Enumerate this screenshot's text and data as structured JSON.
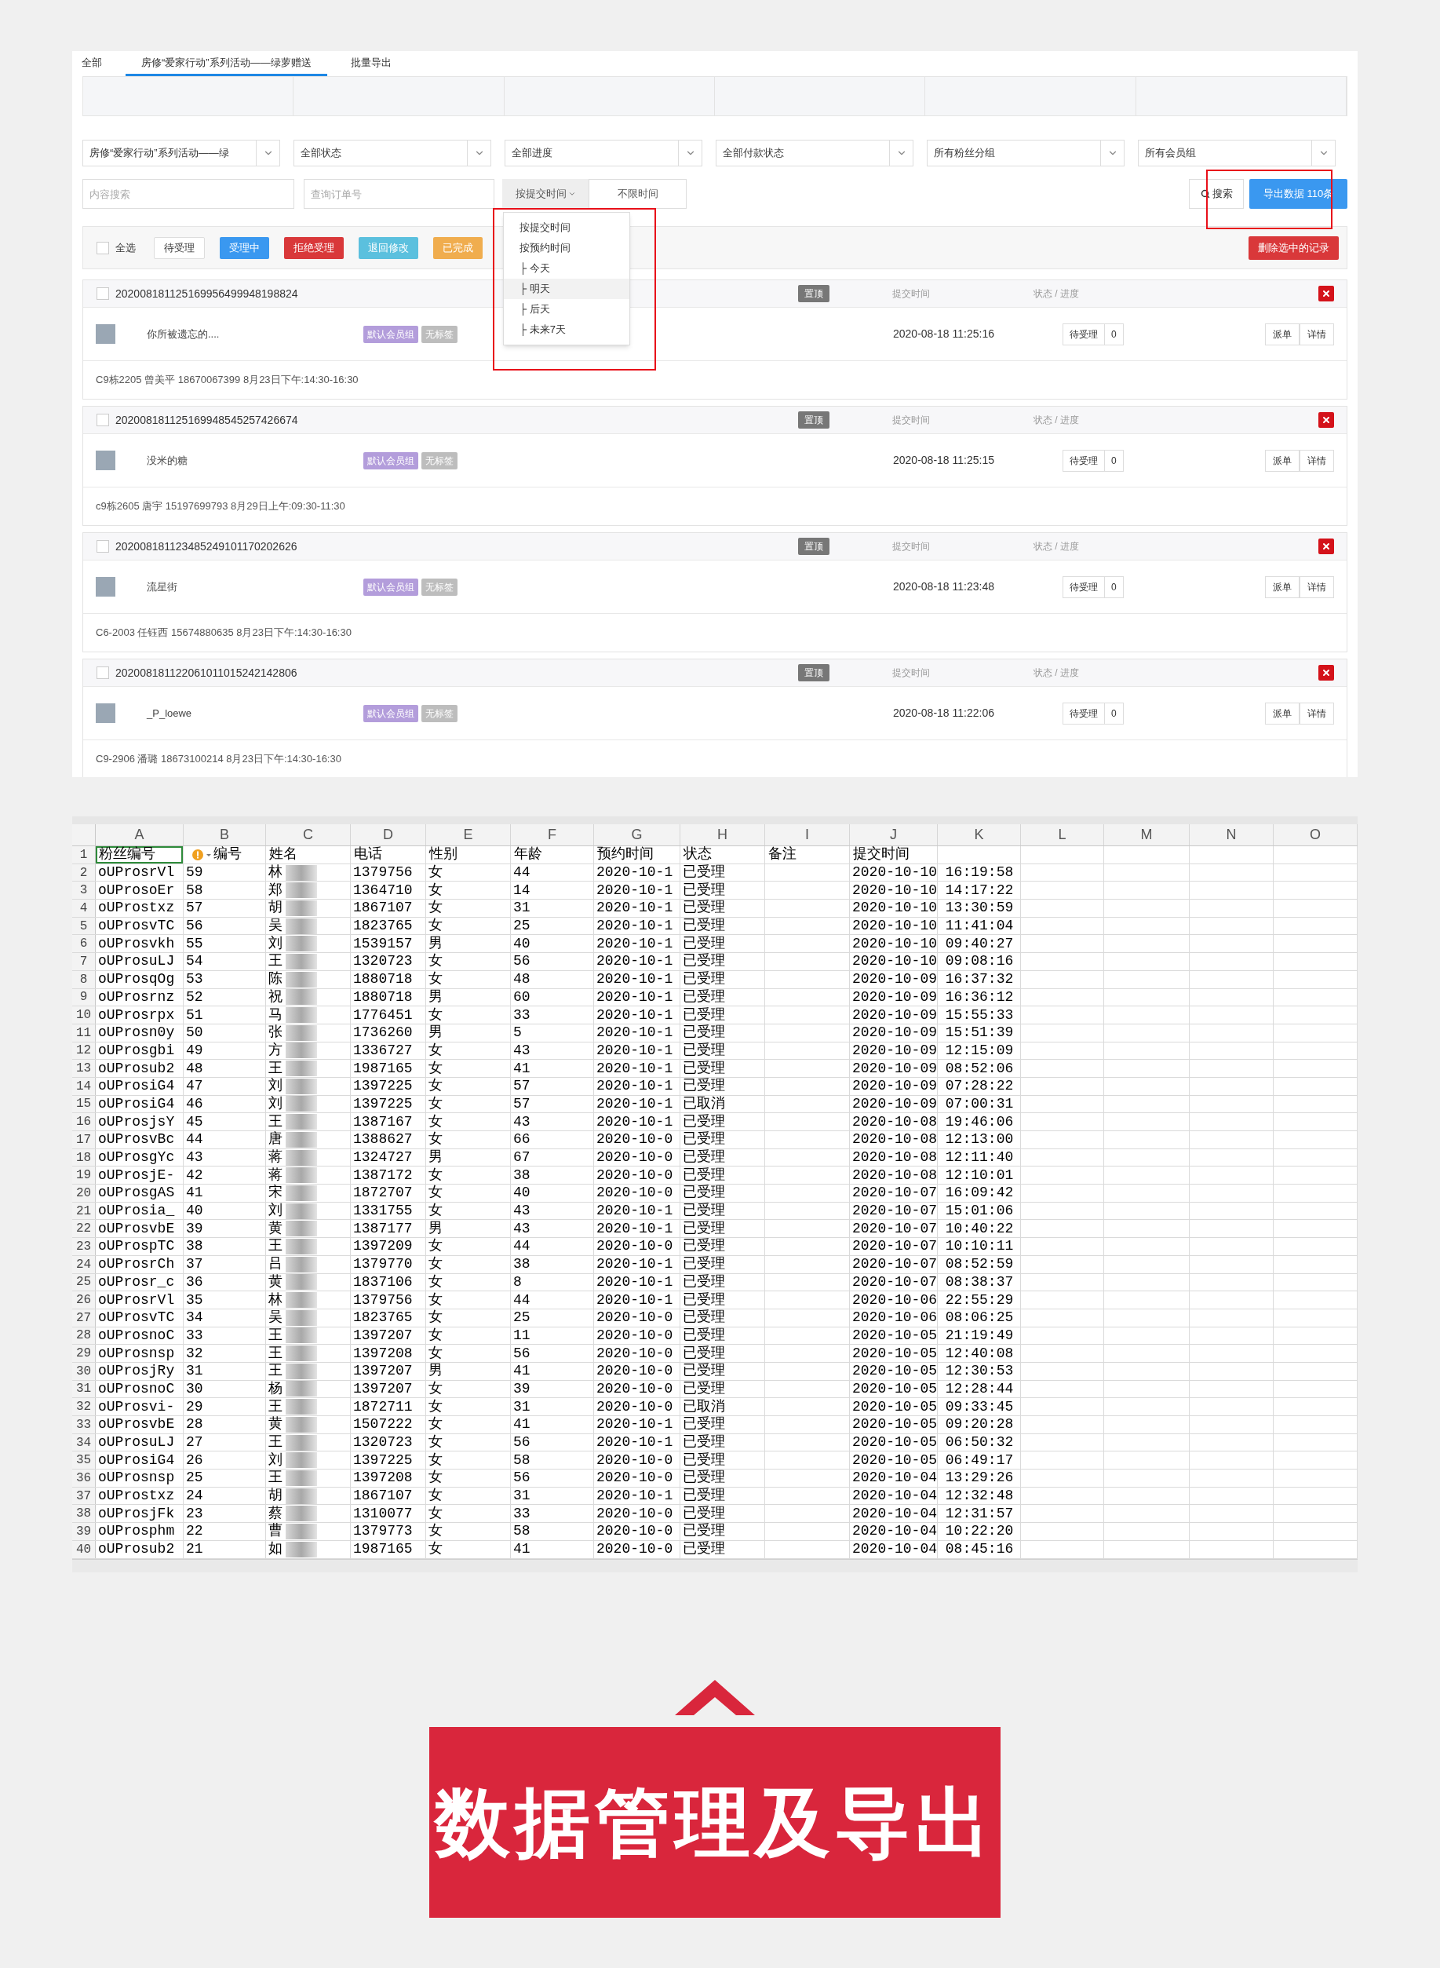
{
  "tabs": [
    {
      "label": "全部",
      "selected": false
    },
    {
      "label": "房修“爱家行动”系列活动——绿萝赠送",
      "selected": true
    },
    {
      "label": "批量导出",
      "selected": false
    }
  ],
  "filters": [
    "房修“爱家行动”系列活动——绿",
    "全部状态",
    "全部进度",
    "全部付款状态",
    "所有粉丝分组",
    "所有会员组"
  ],
  "search_fields": [
    {
      "placeholder": "内容搜索"
    },
    {
      "placeholder": "查询订单号"
    }
  ],
  "time_filter": {
    "mode": "按提交时间",
    "range": "不限时间"
  },
  "search_button": "搜索",
  "export_button": "导出数据 110条",
  "time_menu": [
    {
      "label": "按提交时间",
      "selected": false
    },
    {
      "label": "按预约时间",
      "selected": false
    },
    {
      "label": "├ 今天",
      "selected": false
    },
    {
      "label": "├ 明天",
      "selected": true
    },
    {
      "label": "├ 后天",
      "selected": false
    },
    {
      "label": "├ 未来7天",
      "selected": false
    }
  ],
  "toolbar": {
    "select_all": {
      "label": "全选",
      "checked": false
    },
    "status_buttons": [
      {
        "label": "待受理",
        "kind": "default"
      },
      {
        "label": "受理中",
        "kind": "primary"
      },
      {
        "label": "拒绝受理",
        "kind": "danger"
      },
      {
        "label": "退回修改",
        "kind": "info"
      },
      {
        "label": "已完成",
        "kind": "warning"
      }
    ],
    "delete_button": "删除选中的记录"
  },
  "orders": [
    {
      "order_no": "202008181125169956499948198824",
      "checked": false,
      "pin": "置顶",
      "time_label": "提交时间",
      "status_label": "状态 / 进度",
      "nickname": "你所被遗忘的....",
      "tags": [
        {
          "text": "默认会员组",
          "color": "#b39ddb"
        },
        {
          "text": "无标签",
          "color": "#bdbdbd"
        }
      ],
      "time": "2020-08-18 11:25:16",
      "status": "待受理",
      "count": "0",
      "actions": [
        "派单",
        "详情"
      ],
      "note": "C9栋2205 曾美平 18670067399 8月23日下午:14:30-16:30"
    },
    {
      "order_no": "202008181125169948545257426674",
      "checked": false,
      "pin": "置顶",
      "time_label": "提交时间",
      "status_label": "状态 / 进度",
      "nickname": "没米的糖",
      "tags": [
        {
          "text": "默认会员组",
          "color": "#b39ddb"
        },
        {
          "text": "无标签",
          "color": "#bdbdbd"
        }
      ],
      "time": "2020-08-18 11:25:15",
      "status": "待受理",
      "count": "0",
      "actions": [
        "派单",
        "详情"
      ],
      "note": "c9栋2605 唐宇 15197699793 8月29日上午:09:30-11:30"
    },
    {
      "order_no": "202008181123485249101170202626",
      "checked": false,
      "pin": "置顶",
      "time_label": "提交时间",
      "status_label": "状态 / 进度",
      "nickname": "流星街",
      "tags": [
        {
          "text": "默认会员组",
          "color": "#b39ddb"
        },
        {
          "text": "无标签",
          "color": "#bdbdbd"
        }
      ],
      "time": "2020-08-18 11:23:48",
      "status": "待受理",
      "count": "0",
      "actions": [
        "派单",
        "详情"
      ],
      "note": "C6-2003 任钰西 15674880635 8月23日下午:14:30-16:30"
    },
    {
      "order_no": "202008181122061011015242142806",
      "checked": false,
      "pin": "置顶",
      "time_label": "提交时间",
      "status_label": "状态 / 进度",
      "nickname": "_P_loewe",
      "tags": [
        {
          "text": "默认会员组",
          "color": "#b39ddb"
        },
        {
          "text": "无标签",
          "color": "#bdbdbd"
        }
      ],
      "time": "2020-08-18 11:22:06",
      "status": "待受理",
      "count": "0",
      "actions": [
        "派单",
        "详情"
      ],
      "note": "C9-2906 潘璐 18673100214 8月23日下午:14:30-16:30"
    }
  ],
  "sheet": {
    "columns": [
      "A",
      "B",
      "C",
      "D",
      "E",
      "F",
      "G",
      "H",
      "I",
      "J",
      "K",
      "L",
      "M",
      "N",
      "O"
    ],
    "header": {
      "n": "1",
      "cells": [
        {
          "text": "粉丝编号",
          "selected": true,
          "warning": false
        },
        {
          "text": "编号",
          "selected": false,
          "warning": true
        },
        {
          "text": "姓名",
          "selected": false,
          "warning": false
        },
        {
          "text": "电话",
          "selected": false,
          "warning": false
        },
        {
          "text": "性别",
          "selected": false,
          "warning": false
        },
        {
          "text": "年龄",
          "selected": false,
          "warning": false
        },
        {
          "text": "预约时间",
          "selected": false,
          "warning": false
        },
        {
          "text": "状态",
          "selected": false,
          "warning": false
        },
        {
          "text": "备注",
          "selected": false,
          "warning": false
        },
        {
          "text": "提交时间",
          "selected": false,
          "warning": false
        }
      ]
    },
    "rows": [
      {
        "n": "2",
        "cells": [
          "oUProsrVl",
          "59",
          "林",
          "1379756",
          "女",
          "44",
          "2020-10-1",
          "已受理",
          "2020-10-10 16:19:58"
        ]
      },
      {
        "n": "3",
        "cells": [
          "oUProsoEr",
          "58",
          "郑",
          "1364710",
          "女",
          "14",
          "2020-10-1",
          "已受理",
          "2020-10-10 14:17:22"
        ]
      },
      {
        "n": "4",
        "cells": [
          "oUProstxz",
          "57",
          "胡",
          "1867107",
          "女",
          "31",
          "2020-10-1",
          "已受理",
          "2020-10-10 13:30:59"
        ]
      },
      {
        "n": "5",
        "cells": [
          "oUProsvTC",
          "56",
          "吴",
          "1823765",
          "女",
          "25",
          "2020-10-1",
          "已受理",
          "2020-10-10 11:41:04"
        ]
      },
      {
        "n": "6",
        "cells": [
          "oUProsvkh",
          "55",
          "刘",
          "1539157",
          "男",
          "40",
          "2020-10-1",
          "已受理",
          "2020-10-10 09:40:27"
        ]
      },
      {
        "n": "7",
        "cells": [
          "oUProsuLJ",
          "54",
          "王",
          "1320723",
          "女",
          "56",
          "2020-10-1",
          "已受理",
          "2020-10-10 09:08:16"
        ]
      },
      {
        "n": "8",
        "cells": [
          "oUProsqOg",
          "53",
          "陈",
          "1880718",
          "女",
          "48",
          "2020-10-1",
          "已受理",
          "2020-10-09 16:37:32"
        ]
      },
      {
        "n": "9",
        "cells": [
          "oUProsrnz",
          "52",
          "祝",
          "1880718",
          "男",
          "60",
          "2020-10-1",
          "已受理",
          "2020-10-09 16:36:12"
        ]
      },
      {
        "n": "10",
        "cells": [
          "oUProsrpx",
          "51",
          "马",
          "1776451",
          "女",
          "33",
          "2020-10-1",
          "已受理",
          "2020-10-09 15:55:33"
        ]
      },
      {
        "n": "11",
        "cells": [
          "oUProsn0y",
          "50",
          "张",
          "1736260",
          "男",
          "5",
          "2020-10-1",
          "已受理",
          "2020-10-09 15:51:39"
        ]
      },
      {
        "n": "12",
        "cells": [
          "oUProsgbi",
          "49",
          "方",
          "1336727",
          "女",
          "43",
          "2020-10-1",
          "已受理",
          "2020-10-09 12:15:09"
        ]
      },
      {
        "n": "13",
        "cells": [
          "oUProsub2",
          "48",
          "王",
          "1987165",
          "女",
          "41",
          "2020-10-1",
          "已受理",
          "2020-10-09 08:52:06"
        ]
      },
      {
        "n": "14",
        "cells": [
          "oUProsiG4",
          "47",
          "刘",
          "1397225",
          "女",
          "57",
          "2020-10-1",
          "已受理",
          "2020-10-09 07:28:22"
        ]
      },
      {
        "n": "15",
        "cells": [
          "oUProsiG4",
          "46",
          "刘",
          "1397225",
          "女",
          "57",
          "2020-10-1",
          "已取消",
          "2020-10-09 07:00:31"
        ]
      },
      {
        "n": "16",
        "cells": [
          "oUProsjsY",
          "45",
          "王",
          "1387167",
          "女",
          "43",
          "2020-10-1",
          "已受理",
          "2020-10-08 19:46:06"
        ]
      },
      {
        "n": "17",
        "cells": [
          "oUProsvBc",
          "44",
          "唐",
          "1388627",
          "女",
          "66",
          "2020-10-0",
          "已受理",
          "2020-10-08 12:13:00"
        ]
      },
      {
        "n": "18",
        "cells": [
          "oUProsgYc",
          "43",
          "蒋",
          "1324727",
          "男",
          "67",
          "2020-10-0",
          "已受理",
          "2020-10-08 12:11:40"
        ]
      },
      {
        "n": "19",
        "cells": [
          "oUProsjE-",
          "42",
          "蒋",
          "1387172",
          "女",
          "38",
          "2020-10-0",
          "已受理",
          "2020-10-08 12:10:01"
        ]
      },
      {
        "n": "20",
        "cells": [
          "oUProsgAS",
          "41",
          "宋",
          "1872707",
          "女",
          "40",
          "2020-10-0",
          "已受理",
          "2020-10-07 16:09:42"
        ]
      },
      {
        "n": "21",
        "cells": [
          "oUProsia_",
          "40",
          "刘",
          "1331755",
          "女",
          "43",
          "2020-10-1",
          "已受理",
          "2020-10-07 15:01:06"
        ]
      },
      {
        "n": "22",
        "cells": [
          "oUProsvbE",
          "39",
          "黄",
          "1387177",
          "男",
          "43",
          "2020-10-1",
          "已受理",
          "2020-10-07 10:40:22"
        ]
      },
      {
        "n": "23",
        "cells": [
          "oUProspTC",
          "38",
          "王",
          "1397209",
          "女",
          "44",
          "2020-10-0",
          "已受理",
          "2020-10-07 10:10:11"
        ]
      },
      {
        "n": "24",
        "cells": [
          "oUProsrCh",
          "37",
          "吕",
          "1379770",
          "女",
          "38",
          "2020-10-1",
          "已受理",
          "2020-10-07 08:52:59"
        ]
      },
      {
        "n": "25",
        "cells": [
          "oUProsr_c",
          "36",
          "黄",
          "1837106",
          "女",
          "8",
          "2020-10-1",
          "已受理",
          "2020-10-07 08:38:37"
        ]
      },
      {
        "n": "26",
        "cells": [
          "oUProsrVl",
          "35",
          "林",
          "1379756",
          "女",
          "44",
          "2020-10-1",
          "已受理",
          "2020-10-06 22:55:29"
        ]
      },
      {
        "n": "27",
        "cells": [
          "oUProsvTC",
          "34",
          "吴",
          "1823765",
          "女",
          "25",
          "2020-10-0",
          "已受理",
          "2020-10-06 08:06:25"
        ]
      },
      {
        "n": "28",
        "cells": [
          "oUProsnoC",
          "33",
          "王",
          "1397207",
          "女",
          "11",
          "2020-10-0",
          "已受理",
          "2020-10-05 21:19:49"
        ]
      },
      {
        "n": "29",
        "cells": [
          "oUProsnsp",
          "32",
          "王",
          "1397208",
          "女",
          "56",
          "2020-10-0",
          "已受理",
          "2020-10-05 12:40:08"
        ]
      },
      {
        "n": "30",
        "cells": [
          "oUProsjRy",
          "31",
          "王",
          "1397207",
          "男",
          "41",
          "2020-10-0",
          "已受理",
          "2020-10-05 12:30:53"
        ]
      },
      {
        "n": "31",
        "cells": [
          "oUProsnoC",
          "30",
          "杨",
          "1397207",
          "女",
          "39",
          "2020-10-0",
          "已受理",
          "2020-10-05 12:28:44"
        ]
      },
      {
        "n": "32",
        "cells": [
          "oUProsvi-",
          "29",
          "王",
          "1872711",
          "女",
          "31",
          "2020-10-0",
          "已取消",
          "2020-10-05 09:33:45"
        ]
      },
      {
        "n": "33",
        "cells": [
          "oUProsvbE",
          "28",
          "黄",
          "1507222",
          "女",
          "41",
          "2020-10-1",
          "已受理",
          "2020-10-05 09:20:28"
        ]
      },
      {
        "n": "34",
        "cells": [
          "oUProsuLJ",
          "27",
          "王",
          "1320723",
          "女",
          "56",
          "2020-10-1",
          "已受理",
          "2020-10-05 06:50:32"
        ]
      },
      {
        "n": "35",
        "cells": [
          "oUProsiG4",
          "26",
          "刘",
          "1397225",
          "女",
          "58",
          "2020-10-0",
          "已受理",
          "2020-10-05 06:49:17"
        ]
      },
      {
        "n": "36",
        "cells": [
          "oUProsnsp",
          "25",
          "王",
          "1397208",
          "女",
          "56",
          "2020-10-0",
          "已受理",
          "2020-10-04 13:29:26"
        ]
      },
      {
        "n": "37",
        "cells": [
          "oUProstxz",
          "24",
          "胡",
          "1867107",
          "女",
          "31",
          "2020-10-1",
          "已受理",
          "2020-10-04 12:32:48"
        ]
      },
      {
        "n": "38",
        "cells": [
          "oUProsjFk",
          "23",
          "蔡",
          "1310077",
          "女",
          "33",
          "2020-10-0",
          "已受理",
          "2020-10-04 12:31:57"
        ]
      },
      {
        "n": "39",
        "cells": [
          "oUProsphm",
          "22",
          "曹",
          "1379773",
          "女",
          "58",
          "2020-10-0",
          "已受理",
          "2020-10-04 10:22:20"
        ]
      },
      {
        "n": "40",
        "cells": [
          "oUProsub2",
          "21",
          "如",
          "1987165",
          "女",
          "41",
          "2020-10-0",
          "已受理",
          "2020-10-04 08:45:16"
        ]
      }
    ]
  },
  "banner": {
    "title": "数据管理及导出"
  }
}
